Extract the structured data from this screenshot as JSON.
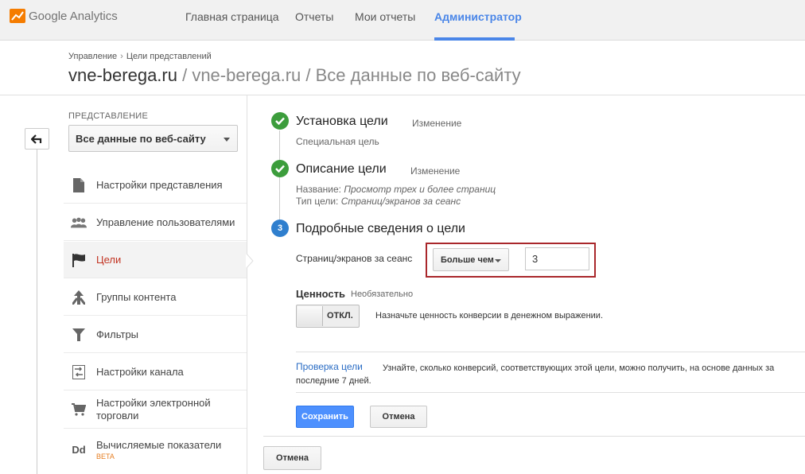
{
  "app": {
    "logo_text": "Google Analytics",
    "accent_color": "#4a86e8"
  },
  "nav": {
    "items": [
      {
        "label": "Главная страница"
      },
      {
        "label": "Отчеты"
      },
      {
        "label": "Мои отчеты"
      },
      {
        "label": "Администратор",
        "active": true
      }
    ]
  },
  "header": {
    "breadcrumb": [
      "Управление",
      "Цели представлений"
    ],
    "breadcrumb_sep": "›",
    "title_main": "vne-berega.ru",
    "title_sub": " / vne-berega.ru / Все данные по веб-сайту"
  },
  "sidebar": {
    "view_label": "ПРЕДСТАВЛЕНИЕ",
    "view_selected": "Все данные по веб-сайту",
    "items": [
      {
        "label": "Настройки представления",
        "icon": "document-icon"
      },
      {
        "label": "Управление пользователями",
        "icon": "users-icon"
      },
      {
        "label": "Цели",
        "icon": "flag-icon",
        "active": true
      },
      {
        "label": "Группы контента",
        "icon": "content-groups-icon"
      },
      {
        "label": "Фильтры",
        "icon": "filter-icon"
      },
      {
        "label": "Настройки канала",
        "icon": "channel-icon"
      },
      {
        "label": "Настройки электронной торговли",
        "icon": "cart-icon"
      },
      {
        "label": "Вычисляемые показатели",
        "icon": "dd-icon",
        "badge": "BETA"
      }
    ]
  },
  "steps": {
    "step1": {
      "title": "Установка цели",
      "edit": "Изменение",
      "detail": "Специальная цель"
    },
    "step2": {
      "title": "Описание цели",
      "edit": "Изменение",
      "name_label": "Название:",
      "name_value": "Просмотр трех и более страниц",
      "type_label": "Тип цели:",
      "type_value": "Страниц/экранов за сеанс"
    },
    "step3": {
      "number": "3",
      "title": "Подробные сведения о цели",
      "field_label": "Страниц/экранов за сеанс",
      "comparison": "Больше чем",
      "value": "3",
      "value_label": "Ценность",
      "value_optional": "Необязательно",
      "toggle_state": "ОТКЛ.",
      "toggle_help": "Назначьте ценность конверсии в денежном выражении.",
      "verify_link": "Проверка цели",
      "verify_text": "Узнайте, сколько конверсий, соответствующих этой цели, можно получить, на основе данных за последние 7 дней.",
      "save_label": "Сохранить",
      "cancel_label": "Отмена"
    }
  },
  "footer": {
    "cancel_label": "Отмена"
  }
}
